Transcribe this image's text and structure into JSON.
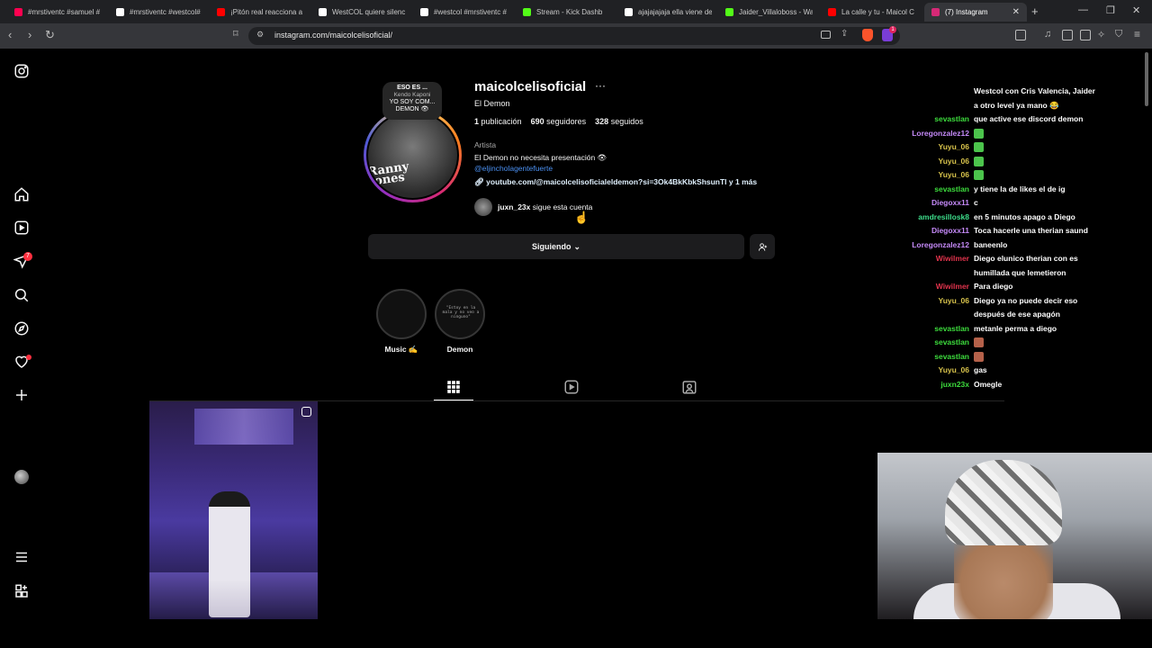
{
  "browser": {
    "tabs": [
      {
        "label": "#mrstiventc #samuel #",
        "fav_color": "#ff0050",
        "active": false
      },
      {
        "label": "#mrstiventc #westcol#",
        "fav_color": "#ffffff",
        "active": false
      },
      {
        "label": "¡Pitón real reacciona a",
        "fav_color": "#ff0000",
        "active": false
      },
      {
        "label": "WestCOL quiere silenc",
        "fav_color": "#ffffff",
        "active": false
      },
      {
        "label": "#westcol #mrstiventc #",
        "fav_color": "#ffffff",
        "active": false
      },
      {
        "label": "Stream - Kick Dashb",
        "fav_color": "#53fc18",
        "active": false
      },
      {
        "label": "ajajajajaja ella viene de",
        "fav_color": "#ffffff",
        "active": false
      },
      {
        "label": "Jaider_Villaloboss - Wa",
        "fav_color": "#53fc18",
        "active": false
      },
      {
        "label": "La calle y tu - Maicol C",
        "fav_color": "#ff0000",
        "active": false
      },
      {
        "label": "(7) Instagram",
        "fav_color": "#d62976",
        "active": true
      }
    ],
    "url": "instagram.com/maicolcelisoficial/",
    "ext_badge": "1"
  },
  "rail": {
    "messages_badge": "7"
  },
  "profile": {
    "username": "maicolcelisoficial",
    "more_label": "···",
    "full_name": "El Demon",
    "posts_count": "1",
    "posts_label": "publicación",
    "followers_count": "690",
    "followers_label": "seguidores",
    "following_count": "328",
    "following_label": "seguidos",
    "category": "Artista",
    "bio": "El Demon no necesita presentación 👁",
    "mention": "@eljincholagentefuerte",
    "link": "youtube.com/@maicolcelisoficialeldemon?si=3Ok4BkKbkShsunTl y 1 más",
    "followed_by_user": "juxn_23x",
    "followed_by_text": "sigue esta cuenta",
    "note": {
      "line1": "ESO ES ...",
      "line2": "Kendo Kaponi",
      "line3": "YO SOY COM...",
      "line4": "DEMON 👁"
    },
    "avatar_text": "Ranny Jones"
  },
  "actions": {
    "following_label": "Siguiendo",
    "following_chevron": "⌄"
  },
  "highlights": [
    {
      "label": "Music ✍️",
      "cover_text": ""
    },
    {
      "label": "Demon",
      "cover_text": "\"Estoy en la mala y no veo a ninguno\""
    }
  ],
  "chat": [
    {
      "user": "",
      "user_color": "#ffffff",
      "msg": "Westcol con Cris Valencia, Jaider a otro level ya mano 😂",
      "lines": 2
    },
    {
      "user": "sevastlan",
      "user_color": "#3ddc3d",
      "msg": "que active ese discord demon",
      "lines": 1
    },
    {
      "user": "Loregonzalez12",
      "user_color": "#c58af9",
      "msg": "",
      "emote": "#4cc44c",
      "lines": 1
    },
    {
      "user": "Yuyu_06",
      "user_color": "#d7c24b",
      "msg": "",
      "emote": "#4cc44c",
      "lines": 1
    },
    {
      "user": "Yuyu_06",
      "user_color": "#d7c24b",
      "msg": "",
      "emote": "#4cc44c",
      "lines": 1
    },
    {
      "user": "Yuyu_06",
      "user_color": "#d7c24b",
      "msg": "",
      "emote": "#4cc44c",
      "lines": 1
    },
    {
      "user": "sevastlan",
      "user_color": "#3ddc3d",
      "msg": "y tiene la de likes el de ig",
      "lines": 1
    },
    {
      "user": "Diegoxx11",
      "user_color": "#c58af9",
      "msg": "c",
      "lines": 1
    },
    {
      "user": "amdresillosk8",
      "user_color": "#3ddc8a",
      "msg": "en 5 minutos apago a Diego",
      "lines": 1
    },
    {
      "user": "Diegoxx11",
      "user_color": "#c58af9",
      "msg": "Toca hacerle una therian saund",
      "lines": 1
    },
    {
      "user": "Loregonzalez12",
      "user_color": "#c58af9",
      "msg": "baneenlo",
      "lines": 1
    },
    {
      "user": "Wiwilmer",
      "user_color": "#e0334c",
      "msg": "Diego elunico therian con es humillada que lemetieron",
      "lines": 2
    },
    {
      "user": "Wiwilmer",
      "user_color": "#e0334c",
      "msg": "Para diego",
      "lines": 1
    },
    {
      "user": "Yuyu_06",
      "user_color": "#d7c24b",
      "msg": "Diego ya no puede decir eso después de ese apagón",
      "lines": 2
    },
    {
      "user": "sevastlan",
      "user_color": "#3ddc3d",
      "msg": "metanle perma a diego",
      "lines": 1
    },
    {
      "user": "sevastlan",
      "user_color": "#3ddc3d",
      "msg": "",
      "emote": "#b5614a",
      "lines": 1
    },
    {
      "user": "sevastlan",
      "user_color": "#3ddc3d",
      "msg": "",
      "emote": "#b5614a",
      "lines": 1
    },
    {
      "user": "Yuyu_06",
      "user_color": "#d7c24b",
      "msg": "gas",
      "lines": 1
    },
    {
      "user": "juxn23x",
      "user_color": "#3ddc3d",
      "msg": "Omegle",
      "lines": 1
    }
  ]
}
